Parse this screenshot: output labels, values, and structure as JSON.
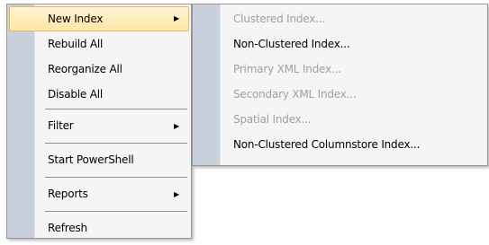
{
  "context_menu": {
    "items": [
      {
        "label": "New Index",
        "arrow": "▶"
      },
      {
        "label": "Rebuild All"
      },
      {
        "label": "Reorganize All"
      },
      {
        "label": "Disable All"
      },
      {
        "label": "Filter",
        "arrow": "▶"
      },
      {
        "label": "Start PowerShell"
      },
      {
        "label": "Reports",
        "arrow": "▶"
      },
      {
        "label": "Refresh"
      }
    ]
  },
  "submenu": {
    "items": [
      {
        "label": "Clustered Index...",
        "enabled": false
      },
      {
        "label": "Non-Clustered Index...",
        "enabled": true
      },
      {
        "label": "Primary XML Index...",
        "enabled": false
      },
      {
        "label": "Secondary XML Index...",
        "enabled": false
      },
      {
        "label": "Spatial Index...",
        "enabled": false
      },
      {
        "label": "Non-Clustered Columnstore Index...",
        "enabled": true
      }
    ]
  },
  "colors": {
    "highlight_border": "#e6bb63",
    "highlight_fill": "#fde5a5",
    "gutter": "#c8d0db",
    "disabled_text": "#a0a0a0"
  }
}
